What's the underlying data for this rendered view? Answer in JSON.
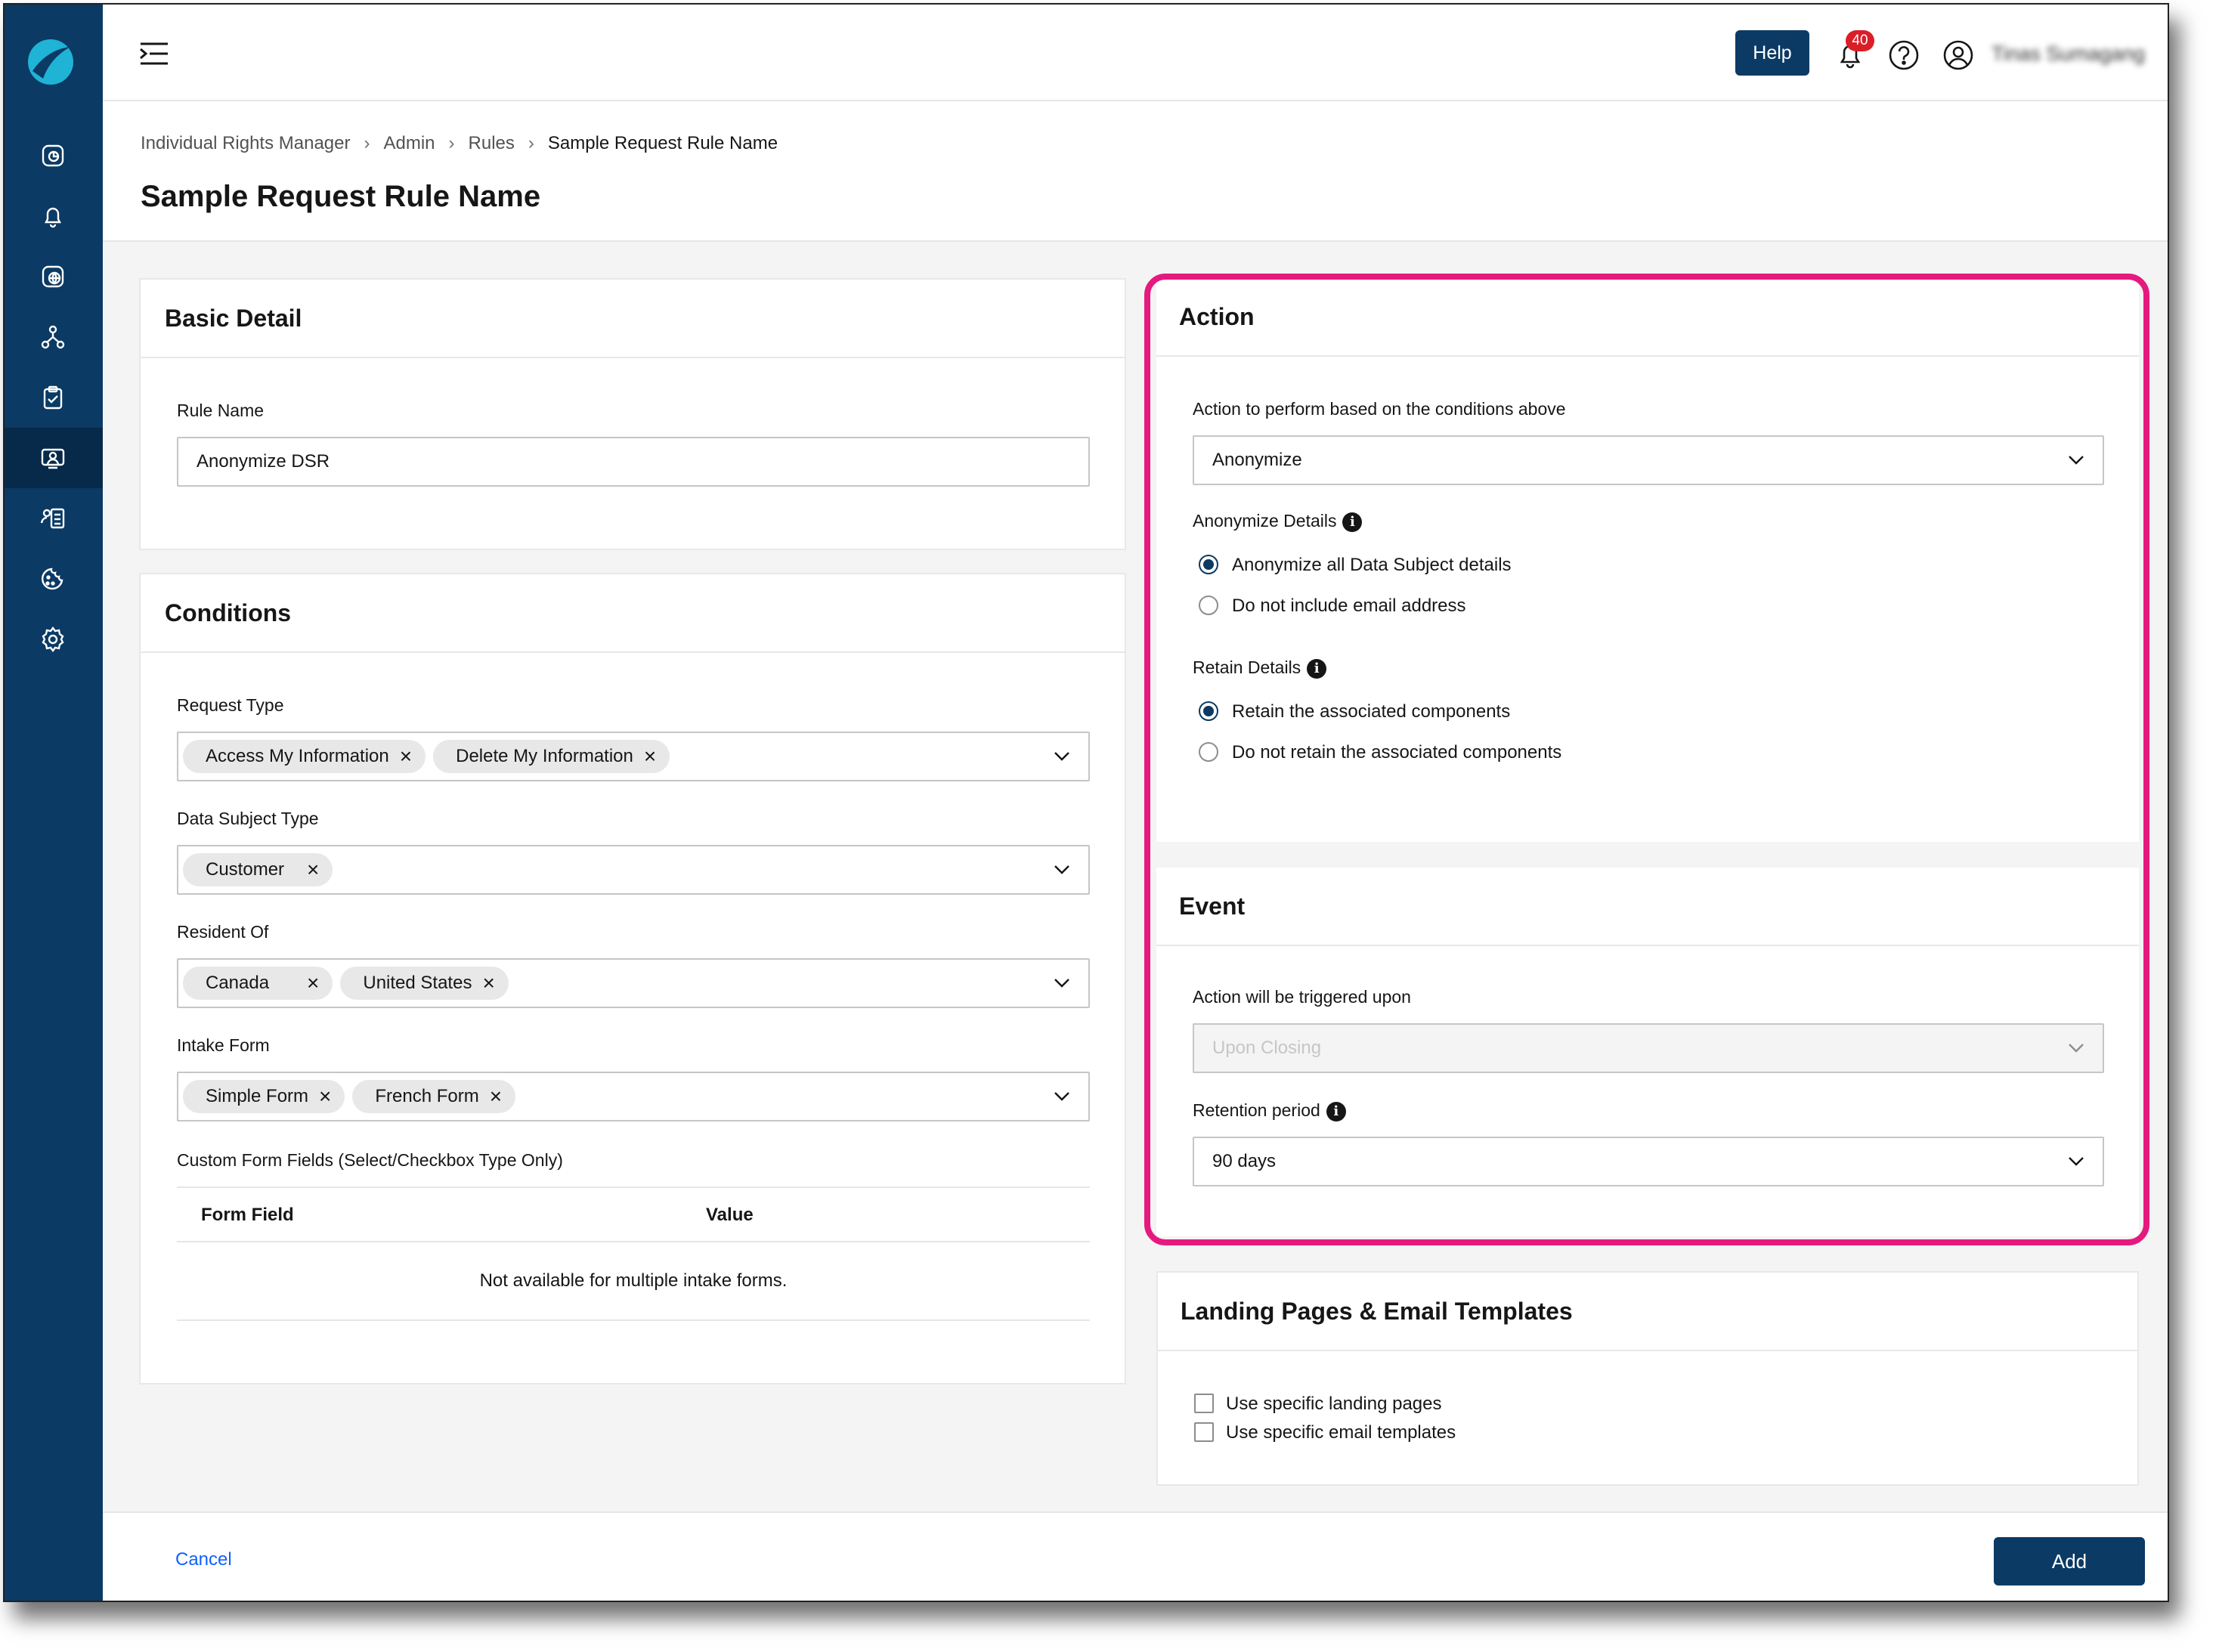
{
  "topbar": {
    "help_label": "Help",
    "notification_count": "40",
    "user_name": "Tinas Sumagang"
  },
  "breadcrumb": [
    "Individual Rights Manager",
    "Admin",
    "Rules",
    "Sample Request Rule Name"
  ],
  "page_title": "Sample Request Rule Name",
  "basic_detail": {
    "title": "Basic Detail",
    "rule_name_label": "Rule Name",
    "rule_name_value": "Anonymize DSR"
  },
  "conditions": {
    "title": "Conditions",
    "request_type_label": "Request Type",
    "request_type_tags": [
      "Access My Information",
      "Delete My Information"
    ],
    "data_subject_type_label": "Data Subject Type",
    "data_subject_type_tags": [
      "Customer"
    ],
    "resident_of_label": "Resident Of",
    "resident_of_tags": [
      "Canada",
      "United States"
    ],
    "intake_form_label": "Intake Form",
    "intake_form_tags": [
      "Simple Form",
      "French Form"
    ],
    "custom_fields_label": "Custom Form Fields (Select/Checkbox Type Only)",
    "col_form_field": "Form Field",
    "col_value": "Value",
    "empty_message": "Not available for multiple intake forms."
  },
  "action": {
    "title": "Action",
    "perform_label": "Action to perform based on the conditions above",
    "perform_value": "Anonymize",
    "anonymize_details_label": "Anonymize Details",
    "anonymize_options": [
      "Anonymize all Data Subject details",
      "Do not include email address"
    ],
    "anonymize_selected": 0,
    "retain_details_label": "Retain Details",
    "retain_options": [
      "Retain the associated components",
      "Do not retain the associated components"
    ],
    "retain_selected": 0
  },
  "event": {
    "title": "Event",
    "trigger_label": "Action will be triggered upon",
    "trigger_placeholder": "Upon Closing",
    "retention_label": "Retention period",
    "retention_value": "90 days"
  },
  "landing": {
    "title": "Landing Pages & Email Templates",
    "opt_landing": "Use specific landing pages",
    "opt_email": "Use specific email templates"
  },
  "footer": {
    "cancel_label": "Cancel",
    "add_label": "Add"
  },
  "colors": {
    "brand": "#0b3a64",
    "highlight": "#e6197e",
    "badge": "#da1e28",
    "link": "#0f62fe"
  }
}
